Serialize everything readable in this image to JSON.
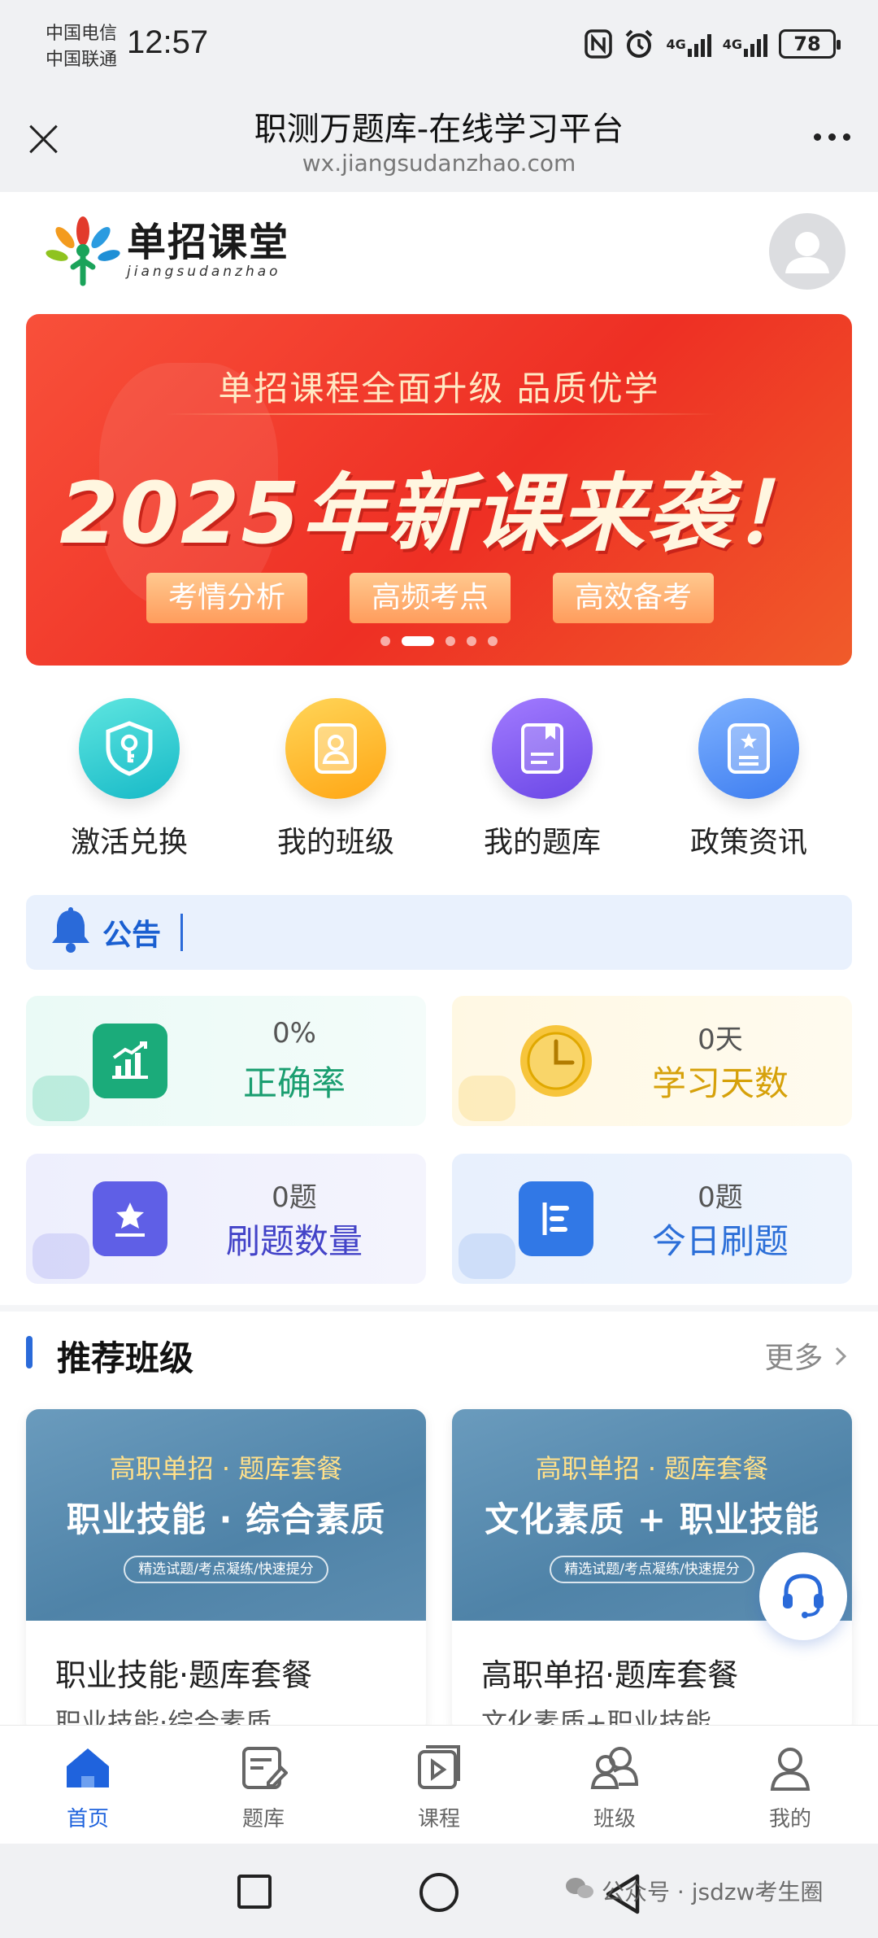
{
  "status_bar": {
    "carrier_1": "中国电信",
    "carrier_2": "中国联通",
    "time": "12:57",
    "network_1": "4G",
    "network_2": "4G",
    "battery": "78",
    "icons": [
      "nfc-icon",
      "alarm-icon",
      "signal-icon",
      "signal-icon",
      "battery-icon"
    ]
  },
  "title_bar": {
    "title": "职测万题库-在线学习平台",
    "url": "wx.jiangsudanzhao.com"
  },
  "header": {
    "logo_name": "单招课堂",
    "logo_sub": "jiangsudanzhao"
  },
  "banner": {
    "subtitle": "单招课程全面升级 品质优学",
    "title": "2025年新课来袭！",
    "tags": [
      "考情分析",
      "高频考点",
      "高效备考"
    ],
    "active_slide": 2,
    "total_slides": 5
  },
  "quick_actions": [
    {
      "label": "激活兑换",
      "icon": "key-shield-icon",
      "color": "#1ec7c9"
    },
    {
      "label": "我的班级",
      "icon": "class-badge-icon",
      "color": "#ffb020"
    },
    {
      "label": "我的题库",
      "icon": "question-book-icon",
      "color": "#7b5cf0"
    },
    {
      "label": "政策资讯",
      "icon": "policy-doc-icon",
      "color": "#4d8df5"
    }
  ],
  "notice": {
    "label": "公告"
  },
  "stats": [
    {
      "value": "0%",
      "label": "正确率",
      "icon": "chart-up-icon",
      "color": "#1bab7a"
    },
    {
      "value": "0天",
      "label": "学习天数",
      "icon": "clock-icon",
      "color": "#e0a800"
    },
    {
      "value": "0题",
      "label": "刷题数量",
      "icon": "star-doc-icon",
      "color": "#5b5be0"
    },
    {
      "value": "0题",
      "label": "今日刷题",
      "icon": "list-doc-icon",
      "color": "#3178e6"
    }
  ],
  "recommend": {
    "title": "推荐班级",
    "more": "更多",
    "cards": [
      {
        "top": "高职单招 · 题库套餐",
        "main": "职业技能 · 综合素质",
        "pill": "精选试题/考点凝练/快速提分",
        "title": "职业技能·题库套餐",
        "sub": "职业技能·综合素质"
      },
      {
        "top": "高职单招 · 题库套餐",
        "main": "文化素质 + 职业技能",
        "pill": "精选试题/考点凝练/快速提分",
        "title": "高职单招·题库套餐",
        "sub": "文化素质+职业技能"
      }
    ]
  },
  "tab_bar": [
    {
      "label": "首页",
      "icon": "home-icon",
      "active": true
    },
    {
      "label": "题库",
      "icon": "edit-doc-icon",
      "active": false
    },
    {
      "label": "课程",
      "icon": "video-icon",
      "active": false
    },
    {
      "label": "班级",
      "icon": "group-icon",
      "active": false
    },
    {
      "label": "我的",
      "icon": "user-icon",
      "active": false
    }
  ],
  "watermark": "公众号 · jsdzw考生圈",
  "colors": {
    "accent": "#1f63dd",
    "banner_red": "#ee2f24"
  }
}
